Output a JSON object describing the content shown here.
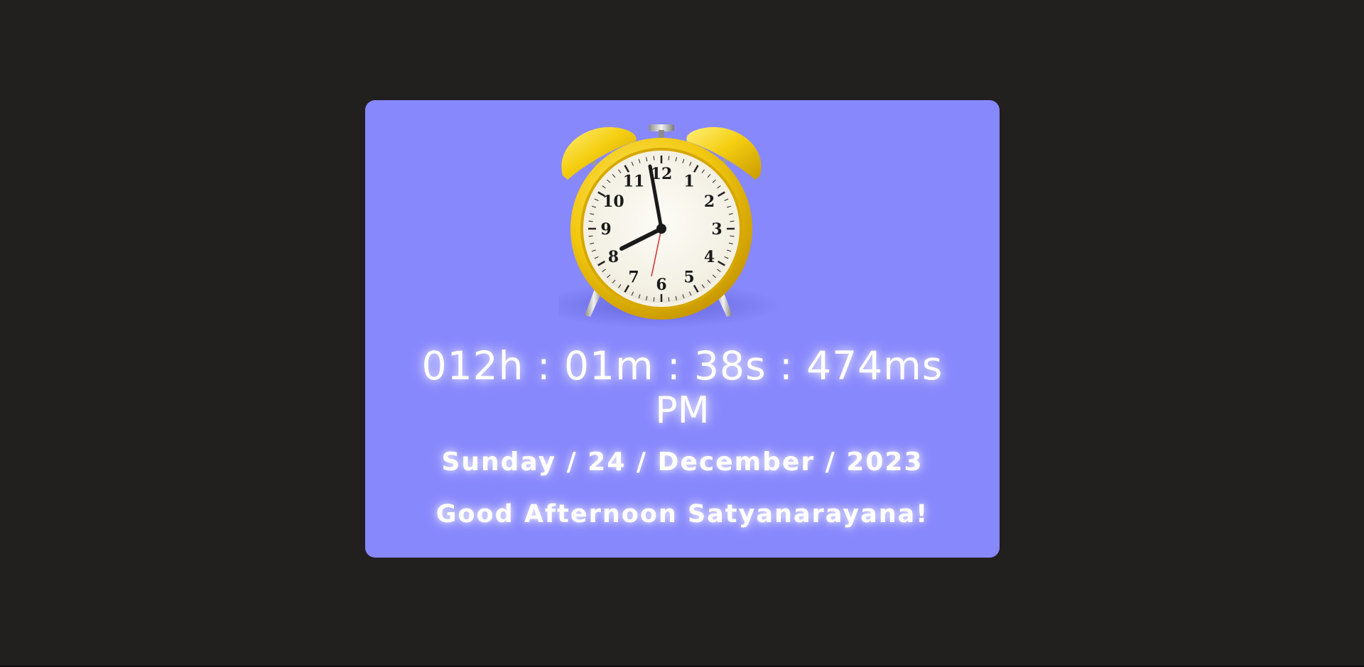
{
  "colors": {
    "page_background": "#221f1f",
    "card_background": "#8888fd",
    "text": "#ffffff",
    "clock_body": "#f2c80f",
    "clock_face": "#f8f5ea"
  },
  "clock": {
    "icon": "alarm-clock-icon",
    "numerals": [
      "12",
      "1",
      "2",
      "3",
      "4",
      "5",
      "6",
      "7",
      "8",
      "9",
      "10",
      "11"
    ]
  },
  "time": {
    "display": "012h : 01m : 38s : 474ms",
    "meridiem": "PM"
  },
  "date": {
    "display": "Sunday / 24 / December / 2023"
  },
  "greeting": {
    "text": "Good Afternoon Satyanarayana!"
  }
}
